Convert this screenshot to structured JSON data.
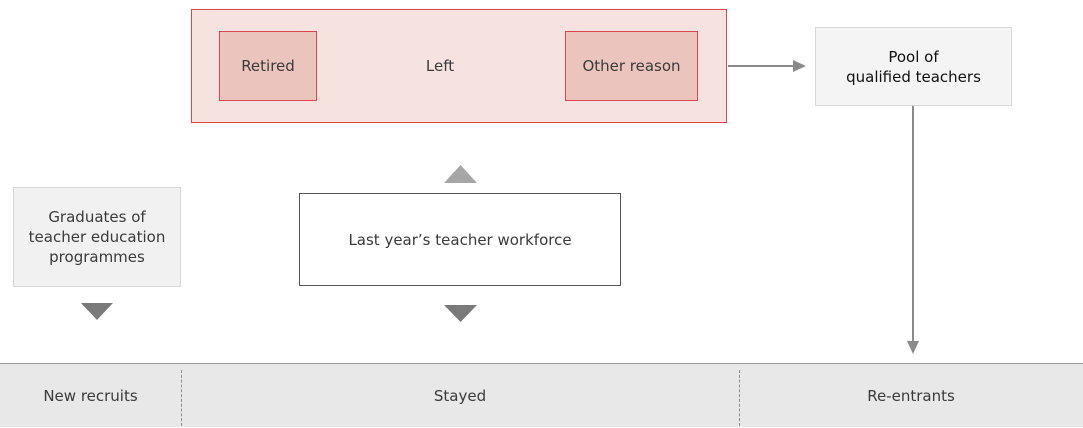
{
  "left_group": {
    "label": "Left",
    "retired_label": "Retired",
    "other_reason_label": "Other reason"
  },
  "pool": {
    "line1": "Pool of",
    "line2": "qualified teachers"
  },
  "graduates": {
    "line1": "Graduates of",
    "line2": "teacher education",
    "line3": "programmes"
  },
  "workforce": {
    "label": "Last year’s teacher workforce"
  },
  "outcomes": {
    "new_recruits": "New recruits",
    "stayed": "Stayed",
    "re_entrants": "Re-entrants"
  },
  "colors": {
    "left_fill": "#f6e3df",
    "left_border": "#d9454f",
    "inner_fill": "#ebc4bd",
    "arrow": "#8a8a8a",
    "band_fill": "#e8e8e9"
  }
}
